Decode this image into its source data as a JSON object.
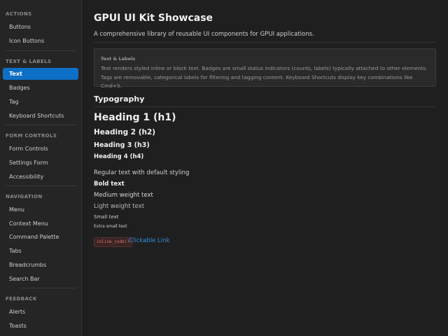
{
  "sidebar": {
    "sections": [
      {
        "title": "ACTIONS",
        "items": [
          {
            "label": "Buttons"
          },
          {
            "label": "Icon Buttons"
          }
        ]
      },
      {
        "title": "TEXT & LABELS",
        "items": [
          {
            "label": "Text"
          },
          {
            "label": "Badges"
          },
          {
            "label": "Tag"
          },
          {
            "label": "Keyboard Shortcuts"
          }
        ]
      },
      {
        "title": "FORM CONTROLS",
        "items": [
          {
            "label": "Form Controls"
          },
          {
            "label": "Settings Form"
          },
          {
            "label": "Accessibility"
          }
        ]
      },
      {
        "title": "NAVIGATION",
        "items": [
          {
            "label": "Menu"
          },
          {
            "label": "Context Menu"
          },
          {
            "label": "Command Palette"
          },
          {
            "label": "Tabs"
          },
          {
            "label": "Breadcrumbs"
          },
          {
            "label": "Search Bar"
          }
        ]
      },
      {
        "title": "FEEDBACK",
        "items": [
          {
            "label": "Alerts"
          },
          {
            "label": "Toasts"
          }
        ]
      }
    ],
    "active_item": "Text",
    "accent_color": "#0e6fc6"
  },
  "main": {
    "title": "GPUI UI Kit Showcase",
    "subtitle": "A comprehensive library of reusable UI components for GPUI applications.",
    "info": {
      "title": "Text & Labels",
      "body": "Text renders styled inline or block text. Badges are small status indicators (counts, labels) typically attached to other elements. Tags are removable, categorical labels for filtering and tagging content. Keyboard Shortcuts display key combinations like Cmd+S."
    },
    "section_title": "Typography",
    "headings": {
      "h1": "Heading 1 (h1)",
      "h2": "Heading 2 (h2)",
      "h3": "Heading 3 (h3)",
      "h4": "Heading 4 (h4)"
    },
    "samples": {
      "regular": "Regular text with default styling",
      "bold": "Bold text",
      "medium": "Medium weight text",
      "light": "Light weight text",
      "small": "Small text",
      "xsmall": "Extra small text"
    },
    "inline_code": "inline_code()",
    "link": "Clickable Link",
    "link_color": "#2f8fdc"
  }
}
